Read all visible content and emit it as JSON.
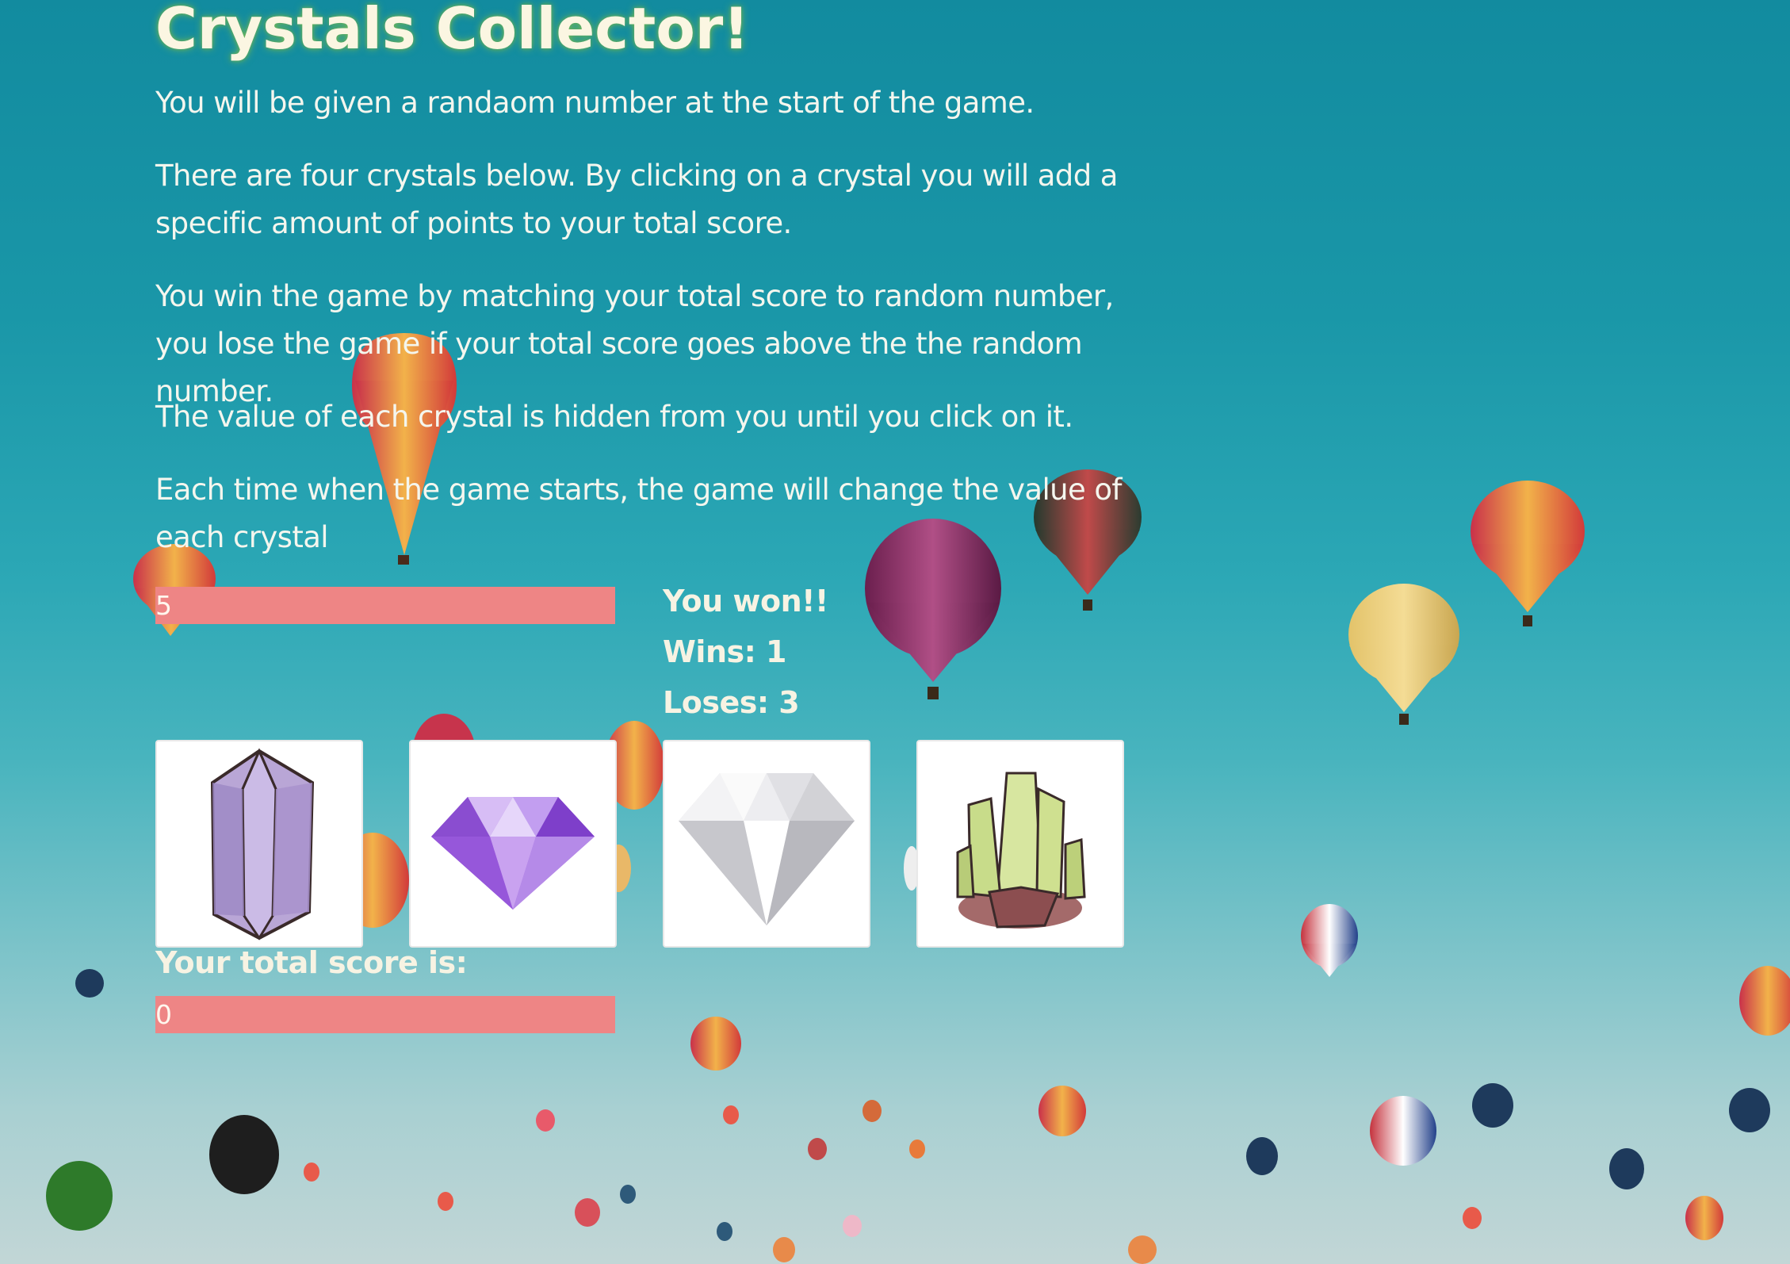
{
  "title": "Crystals Collector!",
  "instructions": [
    "You will be given a randaom number at the start of the game.",
    "There are four crystals below. By clicking on a crystal you will add a specific amount of points to your total score.",
    "You win the game by matching your total score to random number, you lose the game if your total score goes above the the random number.",
    "The value of each crystal is hidden from you until you click on it.",
    "Each time when the game starts, the game will change the value of each crystal"
  ],
  "random_number": "5",
  "result_message": "You won!!",
  "wins_text": "Wins: 1",
  "loses_text": "Loses: 3",
  "total_score_label": "Your total score is:",
  "total_score": "0",
  "crystals": [
    {
      "icon": "purple-prism-crystal-icon"
    },
    {
      "icon": "violet-diamond-icon"
    },
    {
      "icon": "white-diamond-icon"
    },
    {
      "icon": "green-crystal-cluster-icon"
    }
  ],
  "colors": {
    "bar": "#ee8585",
    "title_glow": "#78be5a",
    "sky_top": "#128b9f",
    "sky_bottom": "#c2d6d6"
  }
}
